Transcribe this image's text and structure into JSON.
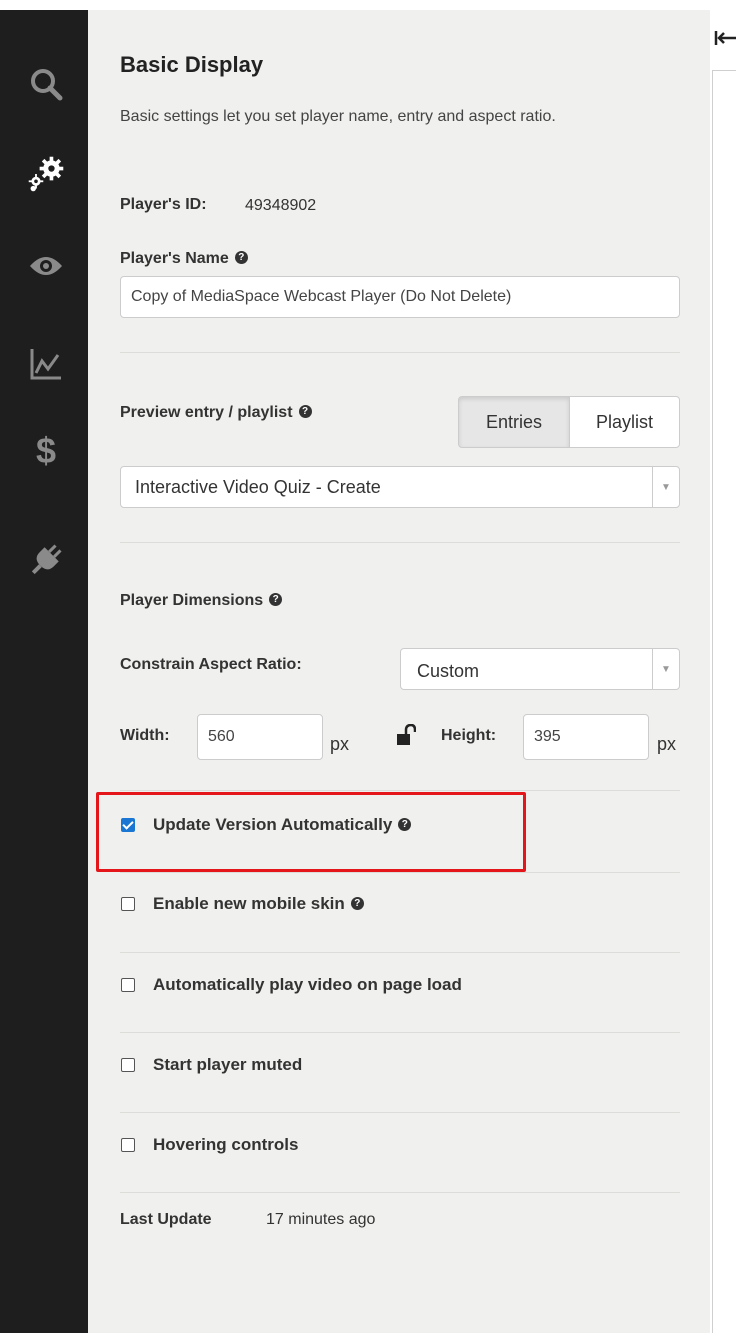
{
  "sidebar": {
    "items": [
      {
        "icon": "search-icon"
      },
      {
        "icon": "gears-icon",
        "active": true
      },
      {
        "icon": "eye-icon"
      },
      {
        "icon": "chart-icon"
      },
      {
        "icon": "dollar-icon"
      },
      {
        "icon": "plug-icon"
      }
    ]
  },
  "header": {
    "title": "Basic Display",
    "description": "Basic settings let you set player name, entry and aspect ratio."
  },
  "player_id": {
    "label": "Player's ID:",
    "value": "49348902"
  },
  "player_name": {
    "label": "Player's Name",
    "value": "Copy of MediaSpace Webcast Player (Do Not Delete)"
  },
  "preview": {
    "label": "Preview entry / playlist",
    "tabs": [
      {
        "label": "Entries",
        "active": true
      },
      {
        "label": "Playlist",
        "active": false
      }
    ],
    "selected": "Interactive Video Quiz - Create"
  },
  "dimensions": {
    "label": "Player Dimensions",
    "constrain_label": "Constrain Aspect Ratio:",
    "constrain_value": "Custom",
    "width_label": "Width:",
    "width_value": "560",
    "width_unit": "px",
    "height_label": "Height:",
    "height_value": "395",
    "height_unit": "px"
  },
  "options": [
    {
      "label": "Update Version Automatically",
      "checked": true,
      "help": true
    },
    {
      "label": "Enable new mobile skin",
      "checked": false,
      "help": true
    },
    {
      "label": "Automatically play video on page load",
      "checked": false,
      "help": false
    },
    {
      "label": "Start player muted",
      "checked": false,
      "help": false
    },
    {
      "label": "Hovering controls",
      "checked": false,
      "help": false
    }
  ],
  "last_update": {
    "label": "Last Update",
    "value": "17 minutes ago"
  },
  "colors": {
    "sidebar_bg": "#1e1e1e",
    "panel_bg": "#f0f0ee",
    "accent": "#1976d2",
    "highlight": "#e4161a"
  }
}
